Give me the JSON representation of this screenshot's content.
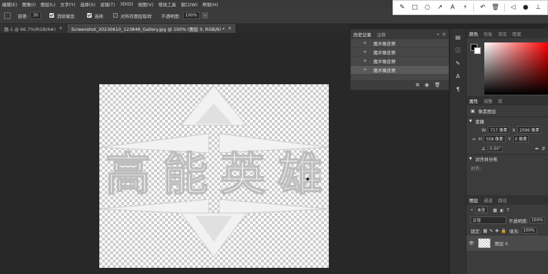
{
  "menu": [
    "编辑(E)",
    "图像(I)",
    "图层(L)",
    "文字(Y)",
    "选择(S)",
    "滤镜(T)",
    "3D(D)",
    "视图(V)",
    "增效工具",
    "窗口(W)",
    "帮助(H)"
  ],
  "options": {
    "tolerance_label": "容差:",
    "tolerance_value": "30",
    "antialias_label": "消除锯齿",
    "contiguous_label": "连续",
    "sample_all_label": "对所有图层取样",
    "opacity_label": "不透明度:",
    "opacity_value": "100%"
  },
  "tabs": [
    {
      "label": "题-1 @ 66.7%(RGB/8#)",
      "close": "×",
      "active": false
    },
    {
      "label": "Screenshot_20230610_123848_Gallery.jpg @ 100% (图层 0, RGB/8) *",
      "close": "×",
      "active": true
    }
  ],
  "history": {
    "tab_active": "历史记录",
    "tab_other": "注释",
    "collapse": "»",
    "menu": "≡",
    "items": [
      "魔术橡皮擦",
      "魔术橡皮擦",
      "魔术橡皮擦",
      "魔术橡皮擦"
    ]
  },
  "color_panel": {
    "tabs": [
      "颜色",
      "色板",
      "渐变",
      "图案"
    ],
    "accent": "#ff0000"
  },
  "properties": {
    "tabs": [
      "属性",
      "调整",
      "库"
    ],
    "kind": "像素图层",
    "transform_label": "变换",
    "w_label": "W",
    "w_value": "717 像素",
    "h_label": "H",
    "h_value": "558 像素",
    "x_label": "X",
    "x_value": "2596 像素",
    "y_label": "Y",
    "y_value": "0 像素",
    "angle_value": "0.00°",
    "align_label": "对齐并分布",
    "align_sub": "对齐:"
  },
  "layers": {
    "tabs": [
      "图层",
      "通道",
      "路径"
    ],
    "filter_kind": "类型",
    "blend_mode": "正常",
    "opacity_label": "不透明度:",
    "opacity_value": "100%",
    "lock_label": "锁定:",
    "fill_label": "填充:",
    "fill_value": "100%",
    "layer_name": "图层 0"
  },
  "artwork": {
    "characters": [
      "高",
      "能",
      "英",
      "雄"
    ]
  }
}
